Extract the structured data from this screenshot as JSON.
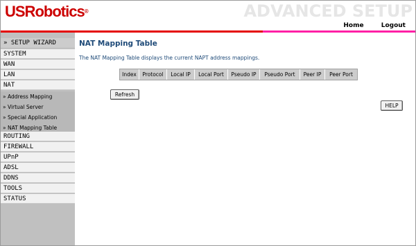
{
  "header": {
    "logo_text": "USRobotics",
    "logo_reg": "®",
    "title": "ADVANCED SETUP",
    "links": {
      "home": "Home",
      "logout": "Logout"
    }
  },
  "colors": {
    "accent_red": "#e50000",
    "accent_pink": "#ff1fa5",
    "title_blue": "#1e4a78"
  },
  "sidebar": {
    "wizard": "» SETUP WIZARD",
    "items_top": [
      "SYSTEM",
      "WAN",
      "LAN",
      "NAT"
    ],
    "nat_sub": [
      "» Address Mapping",
      "» Virtual Server",
      "» Special Application",
      "» NAT Mapping Table"
    ],
    "items_bottom": [
      "ROUTING",
      "FIREWALL",
      "UPnP",
      "ADSL",
      "DDNS",
      "TOOLS",
      "STATUS"
    ]
  },
  "main": {
    "title": "NAT Mapping Table",
    "description": "The NAT Mapping Table displays the current NAPT address mappings.",
    "columns": [
      "Index",
      "Protocol",
      "Local IP",
      "Local Port",
      "Pseudo IP",
      "Pseudo Port",
      "Peer IP",
      "Peer Port"
    ],
    "rows": [],
    "refresh_label": "Refresh",
    "help_label": "HELP"
  }
}
